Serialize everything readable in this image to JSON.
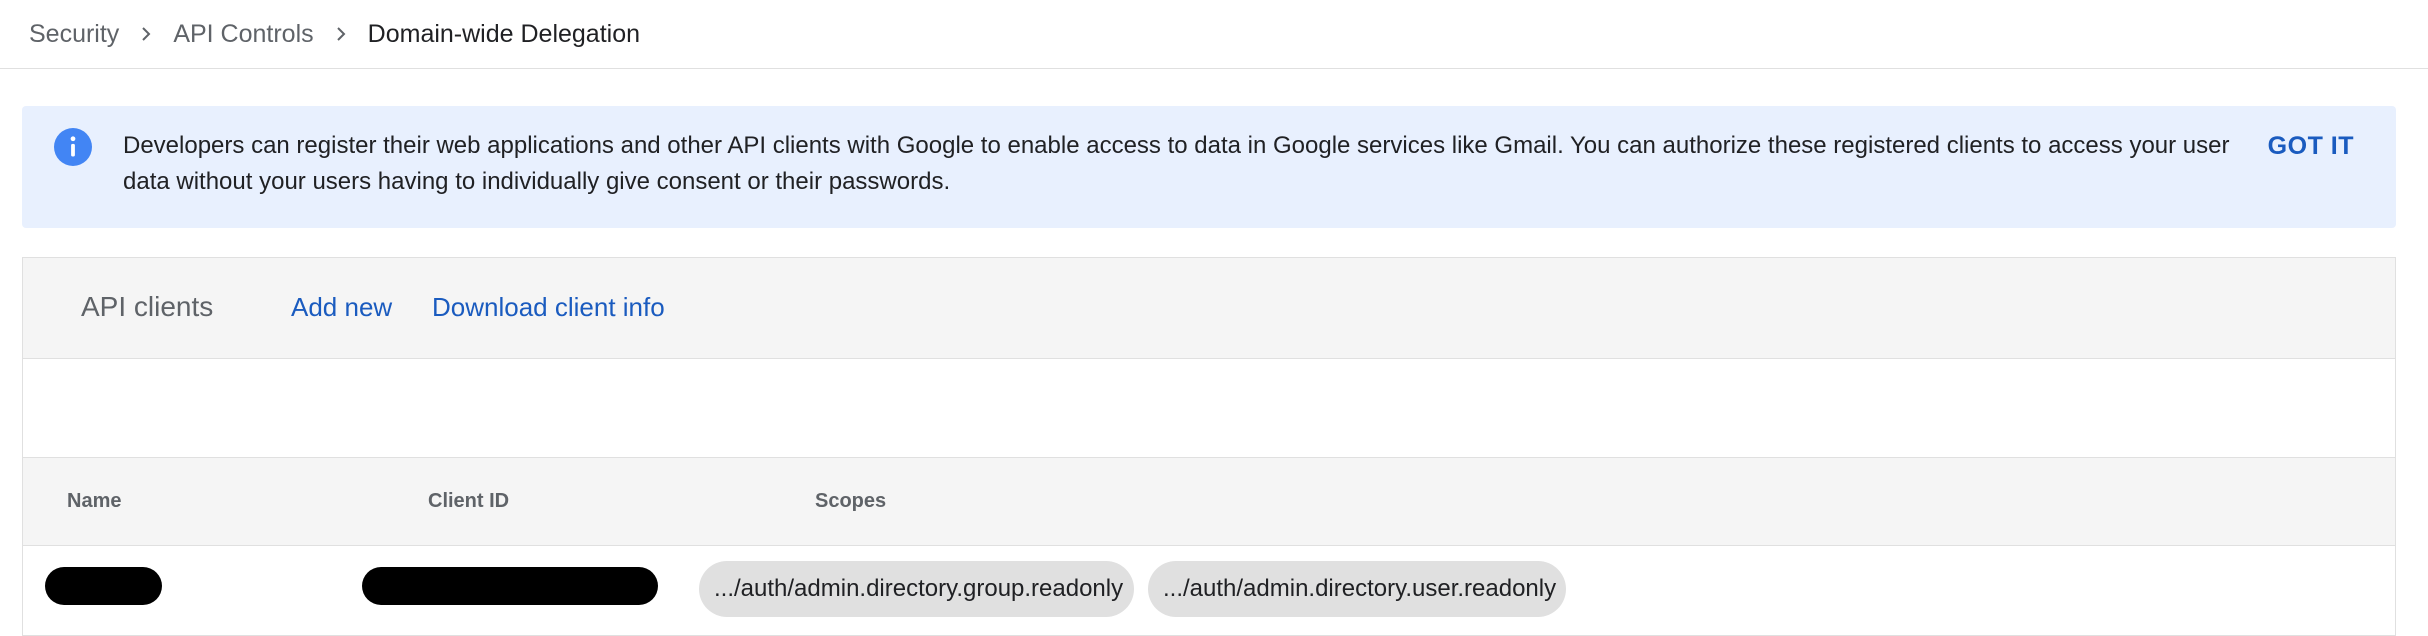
{
  "breadcrumb": {
    "items": [
      "Security",
      "API Controls",
      "Domain-wide Delegation"
    ]
  },
  "banner": {
    "icon": "info-icon",
    "text": "Developers can register their web applications and other API clients with Google to enable access to data in Google services like Gmail. You can authorize these registered clients to access your user data without your users having to individually give consent or their passwords.",
    "action_label": "GOT IT"
  },
  "api_clients": {
    "title": "API clients",
    "add_new_label": "Add new",
    "download_label": "Download client info",
    "columns": [
      "Name",
      "Client ID",
      "Scopes"
    ],
    "rows": [
      {
        "name": "[redacted]",
        "client_id": "[redacted]",
        "scopes": [
          ".../auth/admin.directory.group.readonly",
          ".../auth/admin.directory.user.readonly"
        ]
      }
    ]
  },
  "colors": {
    "accent": "#1a5bbf",
    "banner_bg": "#e8f0fe",
    "info_icon": "#4285f4"
  }
}
